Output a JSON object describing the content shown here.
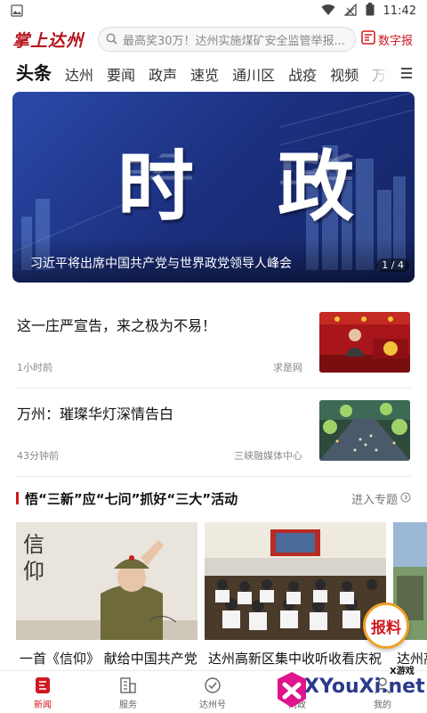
{
  "status_bar": {
    "time": "11:42"
  },
  "header": {
    "logo_text": "掌上达州",
    "search_placeholder": "最高奖30万！达州实施煤矿安全监管举报...",
    "digital_label": "数字报"
  },
  "nav": {
    "tabs": [
      {
        "label": "头条",
        "active": true
      },
      {
        "label": "达州"
      },
      {
        "label": "要闻"
      },
      {
        "label": "政声"
      },
      {
        "label": "速览"
      },
      {
        "label": "通川区"
      },
      {
        "label": "战疫"
      },
      {
        "label": "视频"
      },
      {
        "label": "万达"
      }
    ]
  },
  "banner": {
    "big_text": "时 政",
    "caption": "习近平将出席中国共产党与世界政党领导人峰会",
    "counter": "1 / 4",
    "colors": {
      "bg_dark": "#142464",
      "bg_light": "#2a4aa8"
    }
  },
  "news": [
    {
      "title": "这一庄严宣告，来之极为不易！",
      "time": "1小时前",
      "source": "求是网"
    },
    {
      "title": "万州：璀璨华灯深情告白",
      "time": "43分钟前",
      "source": "三峡融媒体中心"
    }
  ],
  "topic": {
    "title": "悟“三新”应“七问”抓好“三大”活动",
    "more_label": "进入专题",
    "cards": [
      {
        "title": "一首《信仰》  献给中国共产党",
        "image_text": "信仰"
      },
      {
        "title": "达州高新区集中收听收看庆祝"
      },
      {
        "title": "达州高"
      }
    ]
  },
  "float_button": {
    "label": "报料"
  },
  "tabbar": {
    "items": [
      {
        "label": "新闻",
        "active": true
      },
      {
        "label": "服务"
      },
      {
        "label": "达州号"
      },
      {
        "label": "问政"
      },
      {
        "label": "我的"
      }
    ]
  },
  "watermark": {
    "small": "X游戏",
    "big": "XYouXi.net"
  },
  "colors": {
    "accent": "#d0191f",
    "text": "#111111",
    "muted": "#8a8a8a"
  }
}
